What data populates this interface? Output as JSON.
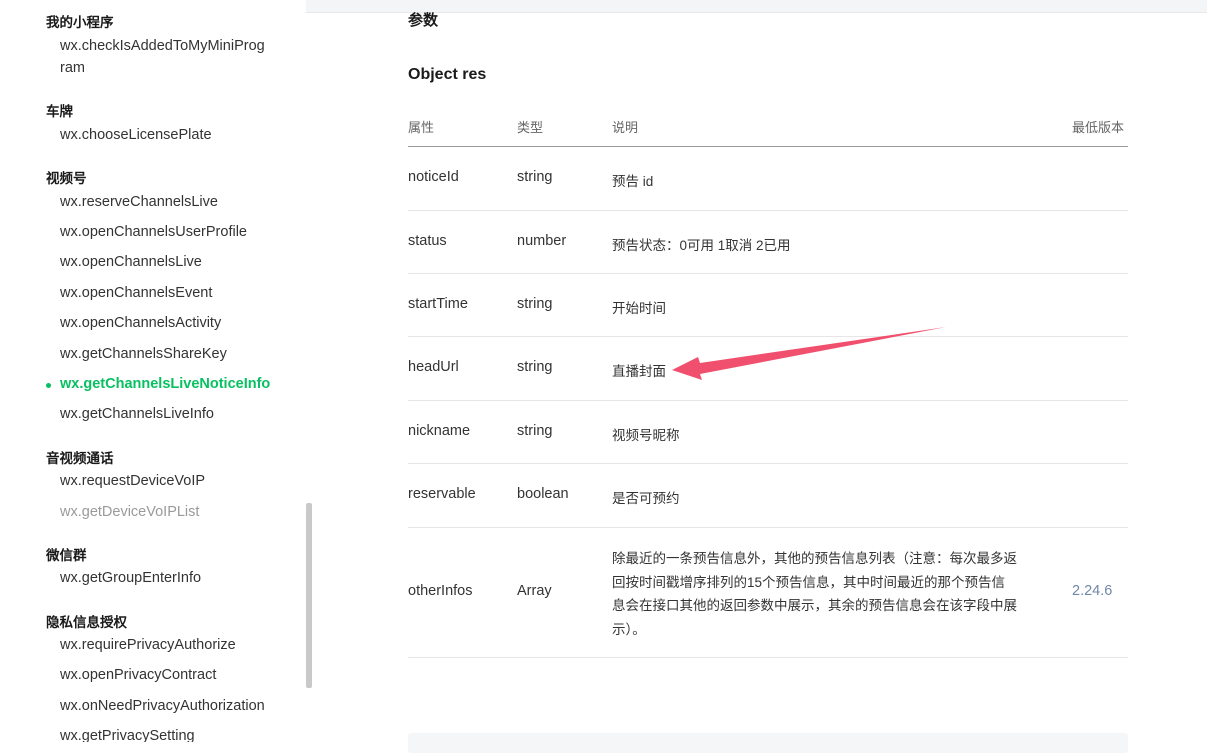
{
  "sidebar": {
    "categories": [
      {
        "label": "我的小程序",
        "items": [
          "wx.checkIsAddedToMyMiniProgram"
        ]
      },
      {
        "label": "车牌",
        "items": [
          "wx.chooseLicensePlate"
        ]
      },
      {
        "label": "视频号",
        "items": [
          "wx.reserveChannelsLive",
          "wx.openChannelsUserProfile",
          "wx.openChannelsLive",
          "wx.openChannelsEvent",
          "wx.openChannelsActivity",
          "wx.getChannelsShareKey",
          "wx.getChannelsLiveNoticeInfo",
          "wx.getChannelsLiveInfo"
        ]
      },
      {
        "label": "音视频通话",
        "items": [
          "wx.requestDeviceVoIP",
          "wx.getDeviceVoIPList"
        ]
      },
      {
        "label": "微信群",
        "items": [
          "wx.getGroupEnterInfo"
        ]
      },
      {
        "label": "隐私信息授权",
        "items": [
          "wx.requirePrivacyAuthorize",
          "wx.openPrivacyContract",
          "wx.onNeedPrivacyAuthorization",
          "wx.getPrivacySetting"
        ]
      }
    ],
    "check_item_line1": "wx.checkIsAddedToMyMiniProg",
    "check_item_line2": "ram",
    "active_item": "wx.getChannelsLiveNoticeInfo",
    "disabled_item": "wx.getDeviceVoIPList"
  },
  "main": {
    "section_title": "参数",
    "object_title": "Object res",
    "headers": {
      "prop": "属性",
      "type": "类型",
      "desc": "说明",
      "version": "最低版本"
    },
    "rows": [
      {
        "prop": "noticeId",
        "type": "string",
        "desc": "预告 id",
        "version": ""
      },
      {
        "prop": "status",
        "type": "number",
        "desc": "预告状态：0可用 1取消 2已用",
        "version": ""
      },
      {
        "prop": "startTime",
        "type": "string",
        "desc": "开始时间",
        "version": ""
      },
      {
        "prop": "headUrl",
        "type": "string",
        "desc": "直播封面",
        "version": ""
      },
      {
        "prop": "nickname",
        "type": "string",
        "desc": "视频号昵称",
        "version": ""
      },
      {
        "prop": "reservable",
        "type": "boolean",
        "desc": "是否可预约",
        "version": ""
      },
      {
        "prop": "otherInfos",
        "type": "Array",
        "desc": "除最近的一条预告信息外，其他的预告信息列表（注意：每次最多返回按时间戳增序排列的15个预告信息，其中时间最近的那个预告信息会在接口其他的返回参数中展示，其余的预告信息会在该字段中展示）。",
        "version": "2.24.6"
      }
    ],
    "long_desc_lines": [
      "除最近的一条预告信息外，其他的预告信息列表（注意：每次最多返",
      "回按时间戳增序排列的15个预告信息，其中时间最近的那个预告信",
      "息会在接口其他的返回参数中展示，其余的预告信息会在该字段中展",
      "示）。"
    ]
  },
  "colors": {
    "accent": "#07c160",
    "arrow": "#f0506e",
    "version": "#7088a6"
  }
}
